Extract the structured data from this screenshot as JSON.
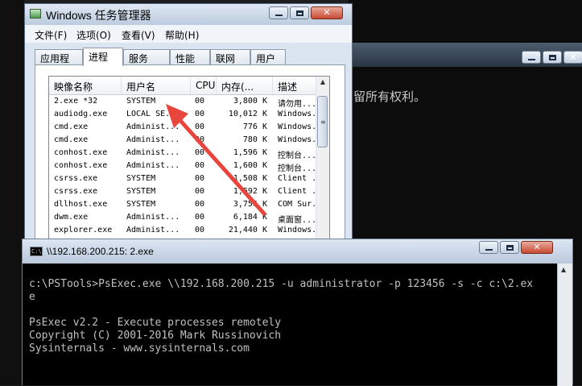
{
  "background_console": {
    "text": "留所有权利。"
  },
  "task_manager": {
    "title": "Windows 任务管理器",
    "menu": [
      "文件(F)",
      "选项(O)",
      "查看(V)",
      "帮助(H)"
    ],
    "tabs": [
      "应用程序",
      "进程",
      "服务",
      "性能",
      "联网",
      "用户"
    ],
    "active_tab": "进程",
    "columns": [
      "映像名称",
      "用户名",
      "CPU",
      "内存(...",
      "描述"
    ],
    "processes": [
      {
        "name": "2.exe *32",
        "user": "SYSTEM",
        "cpu": "00",
        "mem": "3,800 K",
        "desc": "请勿用..."
      },
      {
        "name": "audiodg.exe",
        "user": "LOCAL SE...",
        "cpu": "00",
        "mem": "10,012 K",
        "desc": "Windows..."
      },
      {
        "name": "cmd.exe",
        "user": "Administ...",
        "cpu": "00",
        "mem": "776 K",
        "desc": "Windows..."
      },
      {
        "name": "cmd.exe",
        "user": "Administ...",
        "cpu": "00",
        "mem": "780 K",
        "desc": "Windows..."
      },
      {
        "name": "conhost.exe",
        "user": "Administ...",
        "cpu": "00",
        "mem": "1,596 K",
        "desc": "控制台..."
      },
      {
        "name": "conhost.exe",
        "user": "Administ...",
        "cpu": "00",
        "mem": "1,600 K",
        "desc": "控制台..."
      },
      {
        "name": "csrss.exe",
        "user": "SYSTEM",
        "cpu": "00",
        "mem": "1,508 K",
        "desc": "Client ..."
      },
      {
        "name": "csrss.exe",
        "user": "SYSTEM",
        "cpu": "00",
        "mem": "1,592 K",
        "desc": "Client ..."
      },
      {
        "name": "dllhost.exe",
        "user": "SYSTEM",
        "cpu": "00",
        "mem": "3,756 K",
        "desc": "COM Sur..."
      },
      {
        "name": "dwm.exe",
        "user": "Administ...",
        "cpu": "00",
        "mem": "6,184 K",
        "desc": "桌面窗..."
      },
      {
        "name": "explorer.exe",
        "user": "Administ...",
        "cpu": "00",
        "mem": "21,440 K",
        "desc": "Windows..."
      }
    ]
  },
  "psexec_console": {
    "title": "\\\\192.168.200.215: 2.exe",
    "lines": [
      "c:\\PSTools>PsExec.exe \\\\192.168.200.215 -u administrator -p 123456 -s -c c:\\2.ex",
      "e",
      "",
      "PsExec v2.2 - Execute processes remotely",
      "Copyright (C) 2001-2016 Mark Russinovich",
      "Sysinternals - www.sysinternals.com"
    ]
  },
  "colors": {
    "arrow": "#e8453c",
    "console_text": "#c0c0c0"
  }
}
